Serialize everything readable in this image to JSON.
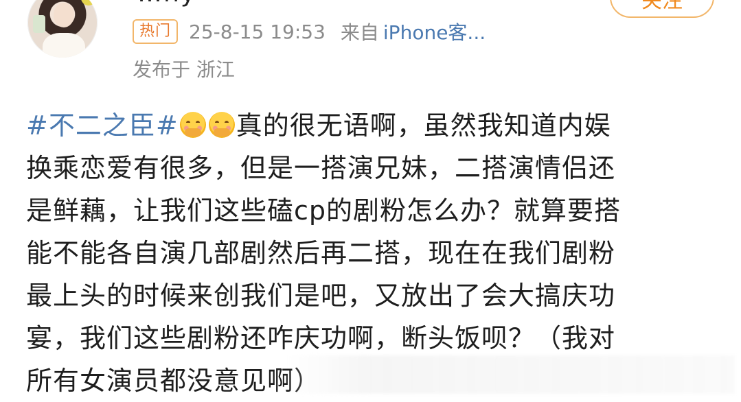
{
  "header": {
    "username_fragment": "…ny",
    "follow_label": "关注",
    "hot_badge": "热门",
    "timestamp": "25-8-15 19:53",
    "source_prefix": "来自",
    "source_client": "iPhone客...",
    "location": "发布于 浙江"
  },
  "post": {
    "hashtag": "#不二之臣#",
    "emojis": [
      "hug-emoji",
      "hug-emoji"
    ],
    "line1_text": "真的很无语啊，虽然我知道内娱",
    "line2": "换乘恋爱有很多，但是一搭演兄妹，二搭演情侣还",
    "line3": "是鲜藕，让我们这些磕cp的剧粉怎么办？就算要搭",
    "line4": "能不能各自演几部剧然后再二搭，现在在我们剧粉",
    "line5": "最上头的时候来创我们是吧，又放出了会大搞庆功",
    "line6": "宴，我们这些剧粉还咋庆功啊，断头饭呗？（我对",
    "line7": "所有女演员都没意见啊）"
  },
  "colors": {
    "link_blue": "#4a79b0",
    "meta_gray": "#8b8b8b",
    "accent_orange": "#f08a1f"
  }
}
